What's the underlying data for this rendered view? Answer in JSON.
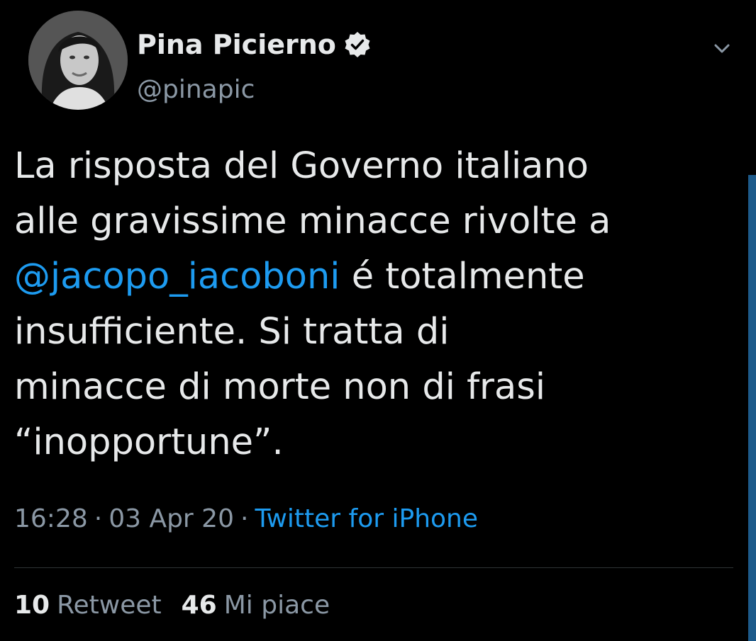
{
  "colors": {
    "background": "#000000",
    "text": "#e7e9ea",
    "secondary_text": "#8b98a5",
    "link": "#1d9bf0",
    "divider": "#2f3336",
    "scrollbar": "#1d5a8a"
  },
  "author": {
    "display_name": "Pina Picierno",
    "handle": "@pinapic",
    "verified": true,
    "avatar_icon": "profile-photo",
    "verified_icon": "verified-badge-icon",
    "menu_icon": "chevron-down-icon"
  },
  "tweet": {
    "line1": "La risposta del Governo italiano",
    "line2": "alle gravissime minacce rivolte a",
    "mention": "@jacopo_iacoboni",
    "line3_rest": " é totalmente",
    "line4": "insufficiente. Si tratta di",
    "line5": "minacce di morte non di frasi",
    "line6": "“inopportune”."
  },
  "meta": {
    "time": "16:28",
    "separator": "·",
    "date": "03 Apr 20",
    "source": "Twitter for iPhone"
  },
  "stats": {
    "retweet_count": "10",
    "retweet_label": "Retweet",
    "like_count": "46",
    "like_label": "Mi piace"
  }
}
